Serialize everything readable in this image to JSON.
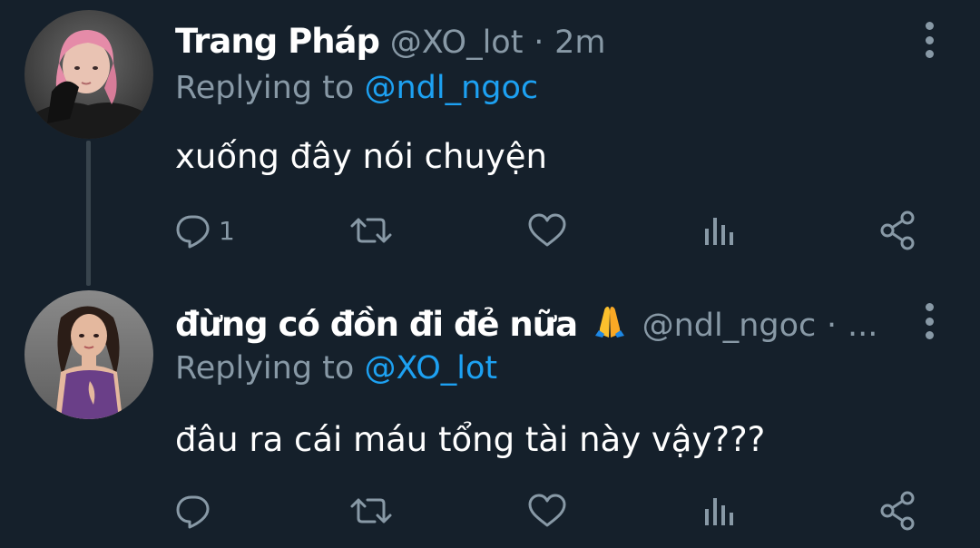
{
  "tweets": [
    {
      "display_name": "Trang Pháp",
      "handle": "@XO_lot",
      "separator": "·",
      "time": "2m",
      "replying_prefix": "Replying to",
      "replying_to": "@ndl_ngoc",
      "text": "xuống đây nói chuyện",
      "reply_count": "1"
    },
    {
      "display_name": "đừng có đồn đi đẻ nữa",
      "handle": "@ndl_ngoc",
      "separator": "·",
      "time": "...",
      "replying_prefix": "Replying to",
      "replying_to": "@XO_lot",
      "text": "đâu ra cái máu tổng tài này vậy???",
      "reply_count": ""
    }
  ],
  "icons": {
    "reply": "reply-icon",
    "retweet": "retweet-icon",
    "like": "heart-icon",
    "stats": "analytics-icon",
    "share": "share-icon",
    "more": "more-vertical-icon",
    "name_emoji": "folded-hands-emoji"
  },
  "colors": {
    "background": "#15202b",
    "text": "#ffffff",
    "secondary": "#8899a6",
    "accent": "#1da1f2",
    "thread_line": "#38444d"
  }
}
